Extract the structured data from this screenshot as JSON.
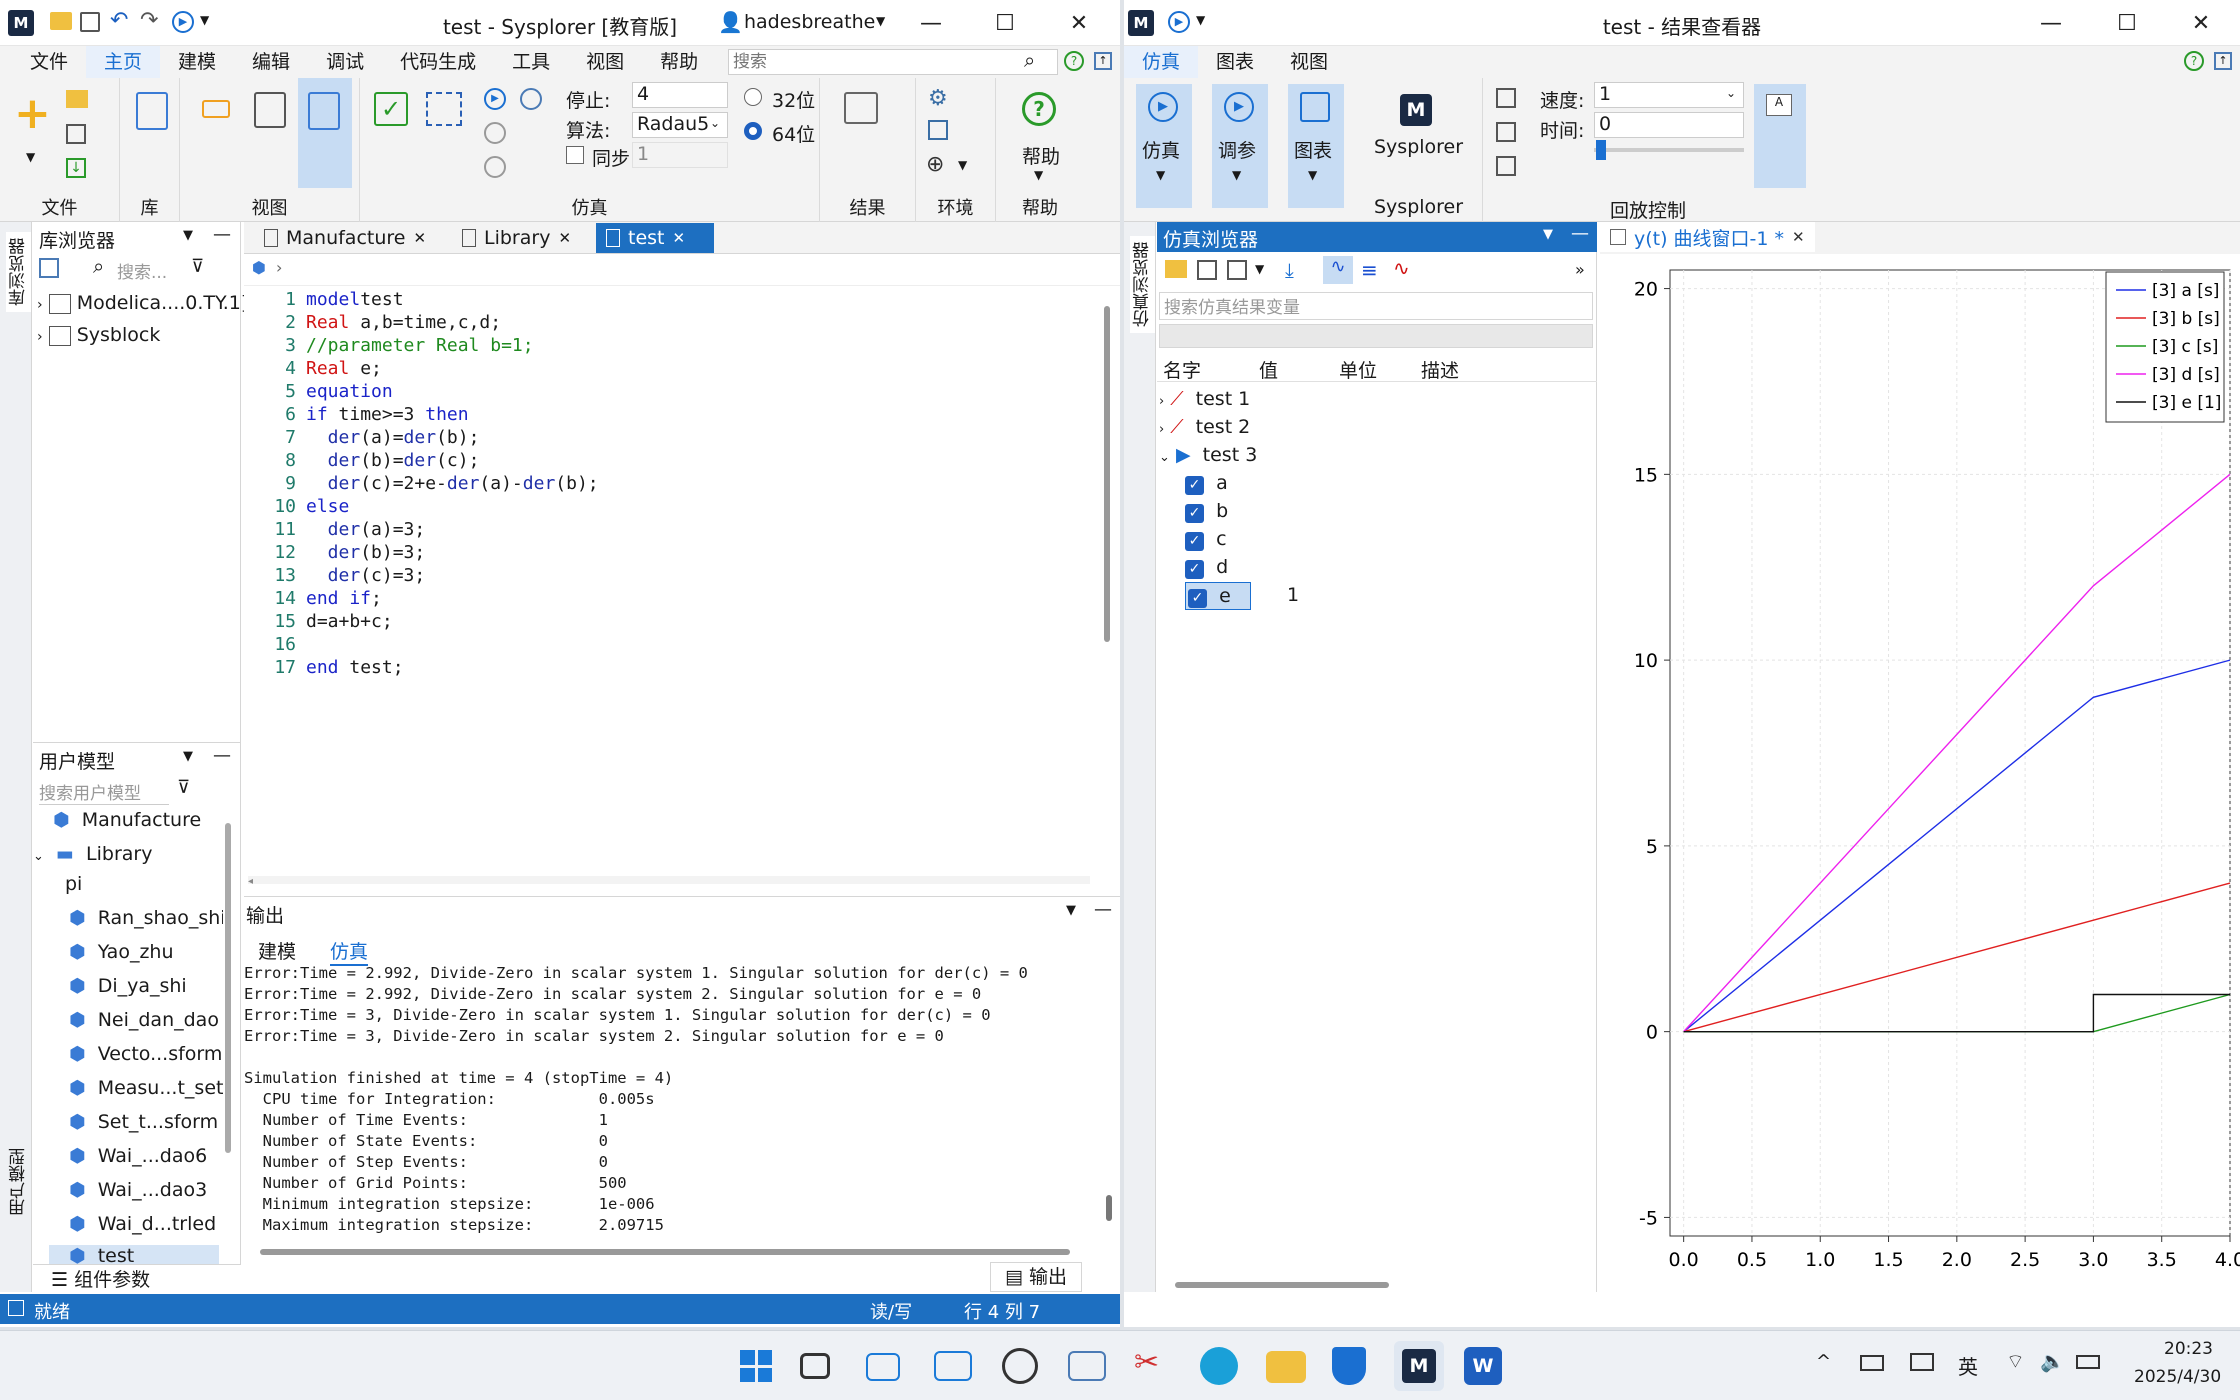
{
  "left_window": {
    "title": "test - Sysplorer [教育版]",
    "user": "hadesbreathe",
    "menu": [
      "文件",
      "主页",
      "建模",
      "编辑",
      "调试",
      "代码生成",
      "工具",
      "视图",
      "帮助"
    ],
    "menu_active": "主页",
    "search_placeholder": "搜索",
    "ribbon": {
      "stop_label": "停止:",
      "stop_value": "4",
      "algo_label": "算法:",
      "algo_value": "Radau5",
      "sync_label": "同步",
      "sync_value": "1",
      "bit32": "32位",
      "bit64": "64位",
      "help_label": "帮助",
      "groups": [
        "文件",
        "库",
        "视图",
        "仿真",
        "结果",
        "环境",
        "帮助"
      ]
    },
    "lib_browser": {
      "title": "库浏览器",
      "search_placeholder": "搜索...",
      "items": [
        "Modelica....0.TY.1]",
        "Sysblock"
      ]
    },
    "side_tab_top": "库浏览器",
    "side_tab_bottom": "用户模型",
    "tabs": [
      "Manufacture",
      "Library",
      "test"
    ],
    "code_lines": [
      [
        [
          "kw",
          "model"
        ],
        [
          "",
          "test"
        ]
      ],
      [
        [
          "rd",
          "Real"
        ],
        [
          "",
          " a,b=time,c,d;"
        ]
      ],
      [
        [
          "gr",
          "//parameter Real b=1;"
        ]
      ],
      [
        [
          "rd",
          "Real"
        ],
        [
          "",
          " e;"
        ]
      ],
      [
        [
          "kw",
          "equation"
        ]
      ],
      [
        [
          "kw",
          "if"
        ],
        [
          "",
          " time>=3 "
        ],
        [
          "kw",
          "then"
        ]
      ],
      [
        [
          "",
          ""
        ],
        [
          "fn",
          "  der"
        ],
        [
          "",
          "(a)="
        ],
        [
          "fn",
          "der"
        ],
        [
          "",
          "(b);"
        ]
      ],
      [
        [
          "",
          ""
        ],
        [
          "fn",
          "  der"
        ],
        [
          "",
          "(b)="
        ],
        [
          "fn",
          "der"
        ],
        [
          "",
          "(c);"
        ]
      ],
      [
        [
          "",
          ""
        ],
        [
          "fn",
          "  der"
        ],
        [
          "",
          "(c)=2+e-"
        ],
        [
          "fn",
          "der"
        ],
        [
          "",
          "(a)-"
        ],
        [
          "fn",
          "der"
        ],
        [
          "",
          "(b);"
        ]
      ],
      [
        [
          "kw",
          "else"
        ]
      ],
      [
        [
          "",
          ""
        ],
        [
          "fn",
          "  der"
        ],
        [
          "",
          "(a)=3;"
        ]
      ],
      [
        [
          "",
          ""
        ],
        [
          "fn",
          "  der"
        ],
        [
          "",
          "(b)=3;"
        ]
      ],
      [
        [
          "",
          ""
        ],
        [
          "fn",
          "  der"
        ],
        [
          "",
          "(c)=3;"
        ]
      ],
      [
        [
          "kw",
          "end if"
        ],
        [
          "",
          ";"
        ]
      ],
      [
        [
          "",
          "d=a+b+c;"
        ]
      ],
      [
        [
          "",
          ""
        ]
      ],
      [
        [
          "kw",
          "end"
        ],
        [
          "",
          " test;"
        ]
      ]
    ],
    "user_models": {
      "title": "用户模型",
      "search_placeholder": "搜索用户模型",
      "items": [
        "Manufacture",
        "Library",
        "pi",
        "Ran_shao_shi",
        "Yao_zhu",
        "Di_ya_shi",
        "Nei_dan_dao",
        "Vecto...sform",
        "Measu...t_set",
        "Set_t...sform",
        "Wai_...dao6",
        "Wai_...dao3",
        "Wai_d...trled",
        "test"
      ]
    },
    "component_params": "组件参数",
    "output": {
      "title": "输出",
      "tabs": [
        "建模",
        "仿真"
      ],
      "lines": [
        "Error:Time = 2.992, Divide-Zero in scalar system 1. Singular solution for der(c) = 0",
        "Error:Time = 2.992, Divide-Zero in scalar system 2. Singular solution for e = 0",
        "Error:Time = 3, Divide-Zero in scalar system 1. Singular solution for der(c) = 0",
        "Error:Time = 3, Divide-Zero in scalar system 2. Singular solution for e = 0",
        "",
        "Simulation finished at time = 4 (stopTime = 4)",
        "  CPU time for Integration:           0.005s",
        "  Number of Time Events:              1",
        "  Number of State Events:             0",
        "  Number of Step Events:              0",
        "  Number of Grid Points:              500",
        "  Minimum integration stepsize:       1e-006",
        "  Maximum integration stepsize:       2.09715"
      ],
      "button": "输出"
    },
    "status": {
      "ready": "就绪",
      "mode": "读/写",
      "pos": "行 4 列 7"
    }
  },
  "right_window": {
    "title": "test - 结果查看器",
    "menu": [
      "仿真",
      "图表",
      "视图"
    ],
    "ribbon": {
      "sim": "仿真",
      "tune": "调参",
      "chart": "图表",
      "sysplorer": "Sysplorer",
      "speed_label": "速度:",
      "speed_value": "1",
      "time_label": "时间:",
      "time_value": "0",
      "group_sysplorer": "Sysplorer",
      "group_playback": "回放控制"
    },
    "side_tab": "仿真浏览器",
    "sim_browser": {
      "title": "仿真浏览器",
      "search_placeholder": "搜索仿真结果变量",
      "columns": [
        "名字",
        "值",
        "单位",
        "描述"
      ],
      "tests": [
        "test 1",
        "test 2",
        "test 3"
      ],
      "vars": [
        {
          "name": "a",
          "value": ""
        },
        {
          "name": "b",
          "value": ""
        },
        {
          "name": "c",
          "value": ""
        },
        {
          "name": "d",
          "value": ""
        },
        {
          "name": "e",
          "value": "1"
        }
      ]
    },
    "plot_tab": "y(t) 曲线窗口-1 *"
  },
  "chart_data": {
    "type": "line",
    "xlim": [
      -0.1,
      4.0
    ],
    "ylim": [
      -5.5,
      20.5
    ],
    "xticks": [
      "0.0",
      "0.5",
      "1.0",
      "1.5",
      "2.0",
      "2.5",
      "3.0",
      "3.5",
      "4.0"
    ],
    "yticks": [
      "-5",
      "0",
      "5",
      "10",
      "15",
      "20"
    ],
    "grid": true,
    "legend_position": "top-right",
    "series": [
      {
        "name": "[3] a [s]",
        "color": "#1e2ee6",
        "x": [
          0,
          3,
          4
        ],
        "y": [
          0,
          9,
          10
        ]
      },
      {
        "name": "[3] b [s]",
        "color": "#e02020",
        "x": [
          0,
          3,
          4
        ],
        "y": [
          0,
          3,
          4
        ]
      },
      {
        "name": "[3] c [s]",
        "color": "#1e9a1e",
        "x": [
          0,
          3,
          4
        ],
        "y": [
          0,
          0,
          1
        ]
      },
      {
        "name": "[3] d [s]",
        "color": "#ee22ee",
        "x": [
          0,
          3,
          4
        ],
        "y": [
          0,
          12,
          15
        ]
      },
      {
        "name": "[3] e [1]",
        "color": "#111111",
        "x": [
          0,
          3,
          3,
          4
        ],
        "y": [
          0,
          0,
          1,
          1
        ]
      }
    ]
  },
  "taskbar": {
    "ime": "英",
    "time": "20:23",
    "date": "2025/4/30"
  }
}
